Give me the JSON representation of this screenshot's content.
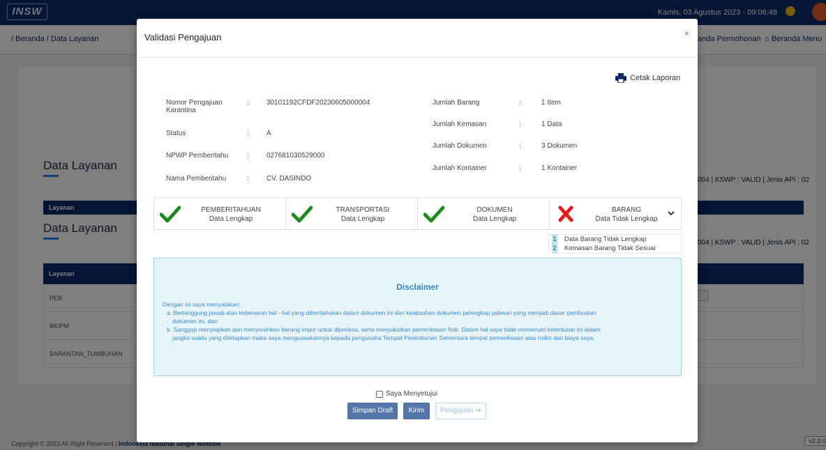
{
  "app": {
    "logo_text": "INSW",
    "datetime": "Kamis, 03 Agustus 2023 - 09:06:48",
    "breadcrumb": "/ Beranda / Data Layanan",
    "nav_permohonan": "anda Permohonan",
    "nav_beranda_menu": "Beranda Menu",
    "card_title_1": "Data Layanan",
    "card_title_2": "Data Layanan",
    "meta_right_1": "004 | KSWP : VALID | Jenis API : 02",
    "meta_right_2": "004 | KSWP : VALID | Jenis API : 02",
    "bar_label_1": "Layanan",
    "table_header": "Layanan",
    "rows": [
      "PEB",
      "BKIPM",
      "BARANTAN_TUMBUHAN"
    ],
    "footer_prefix": "Copyright © 2023 All Right Reserved | ",
    "footer_bold": "Indonesia National Single Window",
    "version": "v2.0.0"
  },
  "modal": {
    "title": "Validasi Pengajuan",
    "close": "×",
    "cetak_label": "Cetak Laporan",
    "info_left": [
      {
        "label": "Nomor Pengajuan Karantina",
        "value": "30101192CFDF20230605000004"
      },
      {
        "label": "Status",
        "value": "A"
      },
      {
        "label": "NPWP Pemberitahu",
        "value": "027681030529000"
      },
      {
        "label": "Nama Pemberitahu",
        "value": "CV. DASINDO"
      }
    ],
    "info_right": [
      {
        "label": "Jumlah Barang",
        "value": "1 Item"
      },
      {
        "label": "Jumlah Kemasan",
        "value": "1 Data"
      },
      {
        "label": "Jumlah Dokumen",
        "value": "3 Dokumen"
      },
      {
        "label": "Jumlah Kontainer",
        "value": "1 Kontainer"
      }
    ],
    "colon": ":",
    "steps": [
      {
        "title": "PEMBERITAHUAN",
        "status": "Data Lengkap",
        "ok": true
      },
      {
        "title": "TRANSPORTASI",
        "status": "Data Lengkap",
        "ok": true
      },
      {
        "title": "DOKUMEN",
        "status": "Data Lengkap",
        "ok": true
      },
      {
        "title": "BARANG",
        "status": "Data Tidak Lengkap",
        "ok": false
      }
    ],
    "errors": [
      {
        "num": "1",
        "text": "Data Barang Tidak Lengkap"
      },
      {
        "num": "2",
        "text": "Kemasan Barang Tidak Sesuai"
      }
    ],
    "disclaimer": {
      "title": "Disclaimer",
      "intro": "Dengan ini saya menyatakan:",
      "a1": "a. Bertanggung jawab atas kebenaran hal - hal yang diberitahukan dalam dokumen ini dan keabsahan dokumen pelengkap pabean yang menjadi dasar pembuatan",
      "a2": "dokumen ini, dan",
      "b1": "b. Sanggup menyiapkan dan menyerahkan barang impor untuk diperiksa, serta menyaksikan pemeriksaan fisik. Dalam hal saya tidak memenuhi ketentutan ini dalam",
      "b2": "jangka waktu yang ditetapkan maka saya menguasakannya kepada pengusaha Tempat Penimbunan Sementara tempat pemeriksaan atas risiko dan biaya saya."
    },
    "agree_label": "Saya Menyetujui",
    "btn_draft": "Simpan Draft",
    "btn_kirim": "Kirim",
    "btn_pengajuan": "Pengajuan",
    "colors": {
      "accent": "#0d2a6a",
      "ok": "#1e8a1e",
      "error": "#e01b1b",
      "disclaimer": "#2f87c4"
    }
  }
}
